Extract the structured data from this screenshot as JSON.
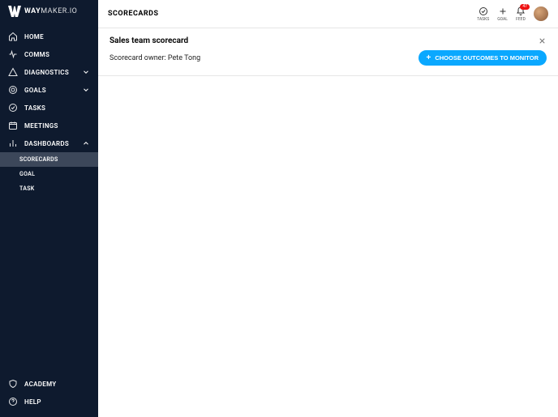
{
  "brand": {
    "name_bold": "WAY",
    "name_rest": "MAKER.IO"
  },
  "sidebar": {
    "items": [
      {
        "label": "HOME"
      },
      {
        "label": "COMMS"
      },
      {
        "label": "DIAGNOSTICS"
      },
      {
        "label": "GOALS"
      },
      {
        "label": "TASKS"
      },
      {
        "label": "MEETINGS"
      },
      {
        "label": "DASHBOARDS"
      }
    ],
    "dashboards_children": [
      {
        "label": "SCORECARDS"
      },
      {
        "label": "GOAL"
      },
      {
        "label": "TASK"
      }
    ],
    "bottom": [
      {
        "label": "ACADEMY"
      },
      {
        "label": "HELP"
      }
    ]
  },
  "topbar": {
    "title": "SCORECARDS",
    "actions": {
      "tasks": "TASKS",
      "goal": "GOAL",
      "feed": "FEED",
      "feed_badge": "47"
    }
  },
  "panel": {
    "title": "Sales team scorecard",
    "owner_line": "Scorecard owner: Pete Tong",
    "cta_label": "CHOOSE OUTCOMES TO MONITOR"
  }
}
